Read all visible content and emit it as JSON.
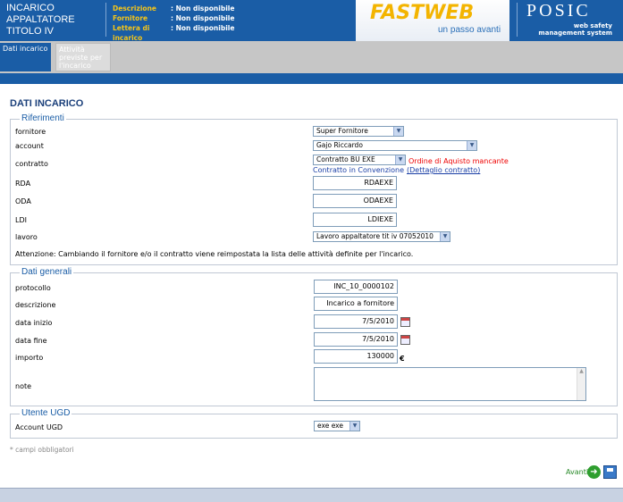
{
  "header": {
    "title_lines": [
      "INCARICO",
      "APPALTATORE",
      "TITOLO IV"
    ],
    "info": [
      {
        "key": "Descrizione",
        "value": ": Non disponibile"
      },
      {
        "key": "Fornitore",
        "value": ": Non disponibile"
      },
      {
        "key": "Lettera di incarico",
        "value": ": Non disponibile"
      }
    ],
    "brand_logo": "FASTWEB",
    "brand_tagline": "un passo avanti",
    "product_logo": "POSIC",
    "product_sub": [
      "web safety",
      "management system"
    ]
  },
  "tabs": [
    {
      "label": "Dati incarico"
    },
    {
      "label": "Attività previste per l'incarico"
    }
  ],
  "page_title": "DATI INCARICO",
  "riferimenti": {
    "legend": "Riferimenti",
    "fornitore": {
      "label": "fornitore",
      "value": "Super Fornitore"
    },
    "account": {
      "label": "account",
      "value": "Gajo Riccardo"
    },
    "contratto": {
      "label": "contratto",
      "value": "Contratto BU EXE",
      "warning": "Ordine di Aquisto mancante",
      "note": "Contratto in Convenzione",
      "link": "(Dettaglio contratto)"
    },
    "rda": {
      "label": "RDA",
      "value": "RDAEXE"
    },
    "oda": {
      "label": "ODA",
      "value": "ODAEXE"
    },
    "ldi": {
      "label": "LDI",
      "value": "LDIEXE"
    },
    "lavoro": {
      "label": "lavoro",
      "value": "Lavoro appaltatore tit iv 07052010"
    },
    "attenzione": "Attenzione: Cambiando il fornitore e/o il contratto viene reimpostata la lista delle attività definite per l'incarico."
  },
  "dati_generali": {
    "legend": "Dati generali",
    "protocollo": {
      "label": "protocollo",
      "value": "INC_10_0000102"
    },
    "descrizione": {
      "label": "descrizione",
      "value": "Incarico a fornitore"
    },
    "data_inizio": {
      "label": "data inizio",
      "value": "7/5/2010"
    },
    "data_fine": {
      "label": "data fine",
      "value": "7/5/2010"
    },
    "importo": {
      "label": "importo",
      "value": "130000",
      "currency": "€"
    },
    "note": {
      "label": "note",
      "value": ""
    }
  },
  "utente_ugd": {
    "legend": "Utente UGD",
    "account_ugd": {
      "label": "Account UGD",
      "value": "exe exe"
    }
  },
  "required_note": "* campi obbligatori",
  "next_label": "Avanti",
  "colors": {
    "brand_blue": "#1a5da6",
    "warning_red": "#e00000",
    "fastweb_yellow": "#f3b400"
  }
}
